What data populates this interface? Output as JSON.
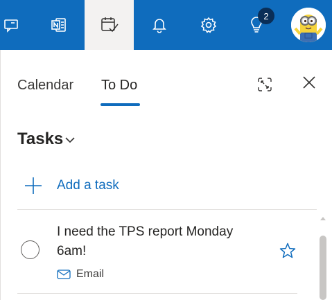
{
  "topbar": {
    "buttons": [
      {
        "name": "feedback-button",
        "icon": "chat-feedback-icon"
      },
      {
        "name": "onenote-button",
        "icon": "onenote-icon"
      },
      {
        "name": "my-day-button",
        "icon": "calendar-check-icon",
        "active": true
      },
      {
        "name": "notifications-button",
        "icon": "bell-icon"
      },
      {
        "name": "settings-button",
        "icon": "gear-icon"
      },
      {
        "name": "tips-button",
        "icon": "lightbulb-icon"
      }
    ],
    "tips_badge": "2",
    "accent_color": "#0f6cbd",
    "avatar": "user-avatar-minion"
  },
  "pane": {
    "tabs": [
      {
        "label": "Calendar",
        "selected": false
      },
      {
        "label": "To Do",
        "selected": true
      }
    ],
    "expand_icon": "expand-icon",
    "close_icon": "close-icon"
  },
  "tasks": {
    "heading": "Tasks",
    "heading_icon": "chevron-down-icon",
    "add_task_label": "Add a task",
    "items": [
      {
        "title": "I need the TPS report Monday 6am!",
        "source_label": "Email",
        "source_icon": "mail-icon",
        "important": false
      }
    ]
  }
}
